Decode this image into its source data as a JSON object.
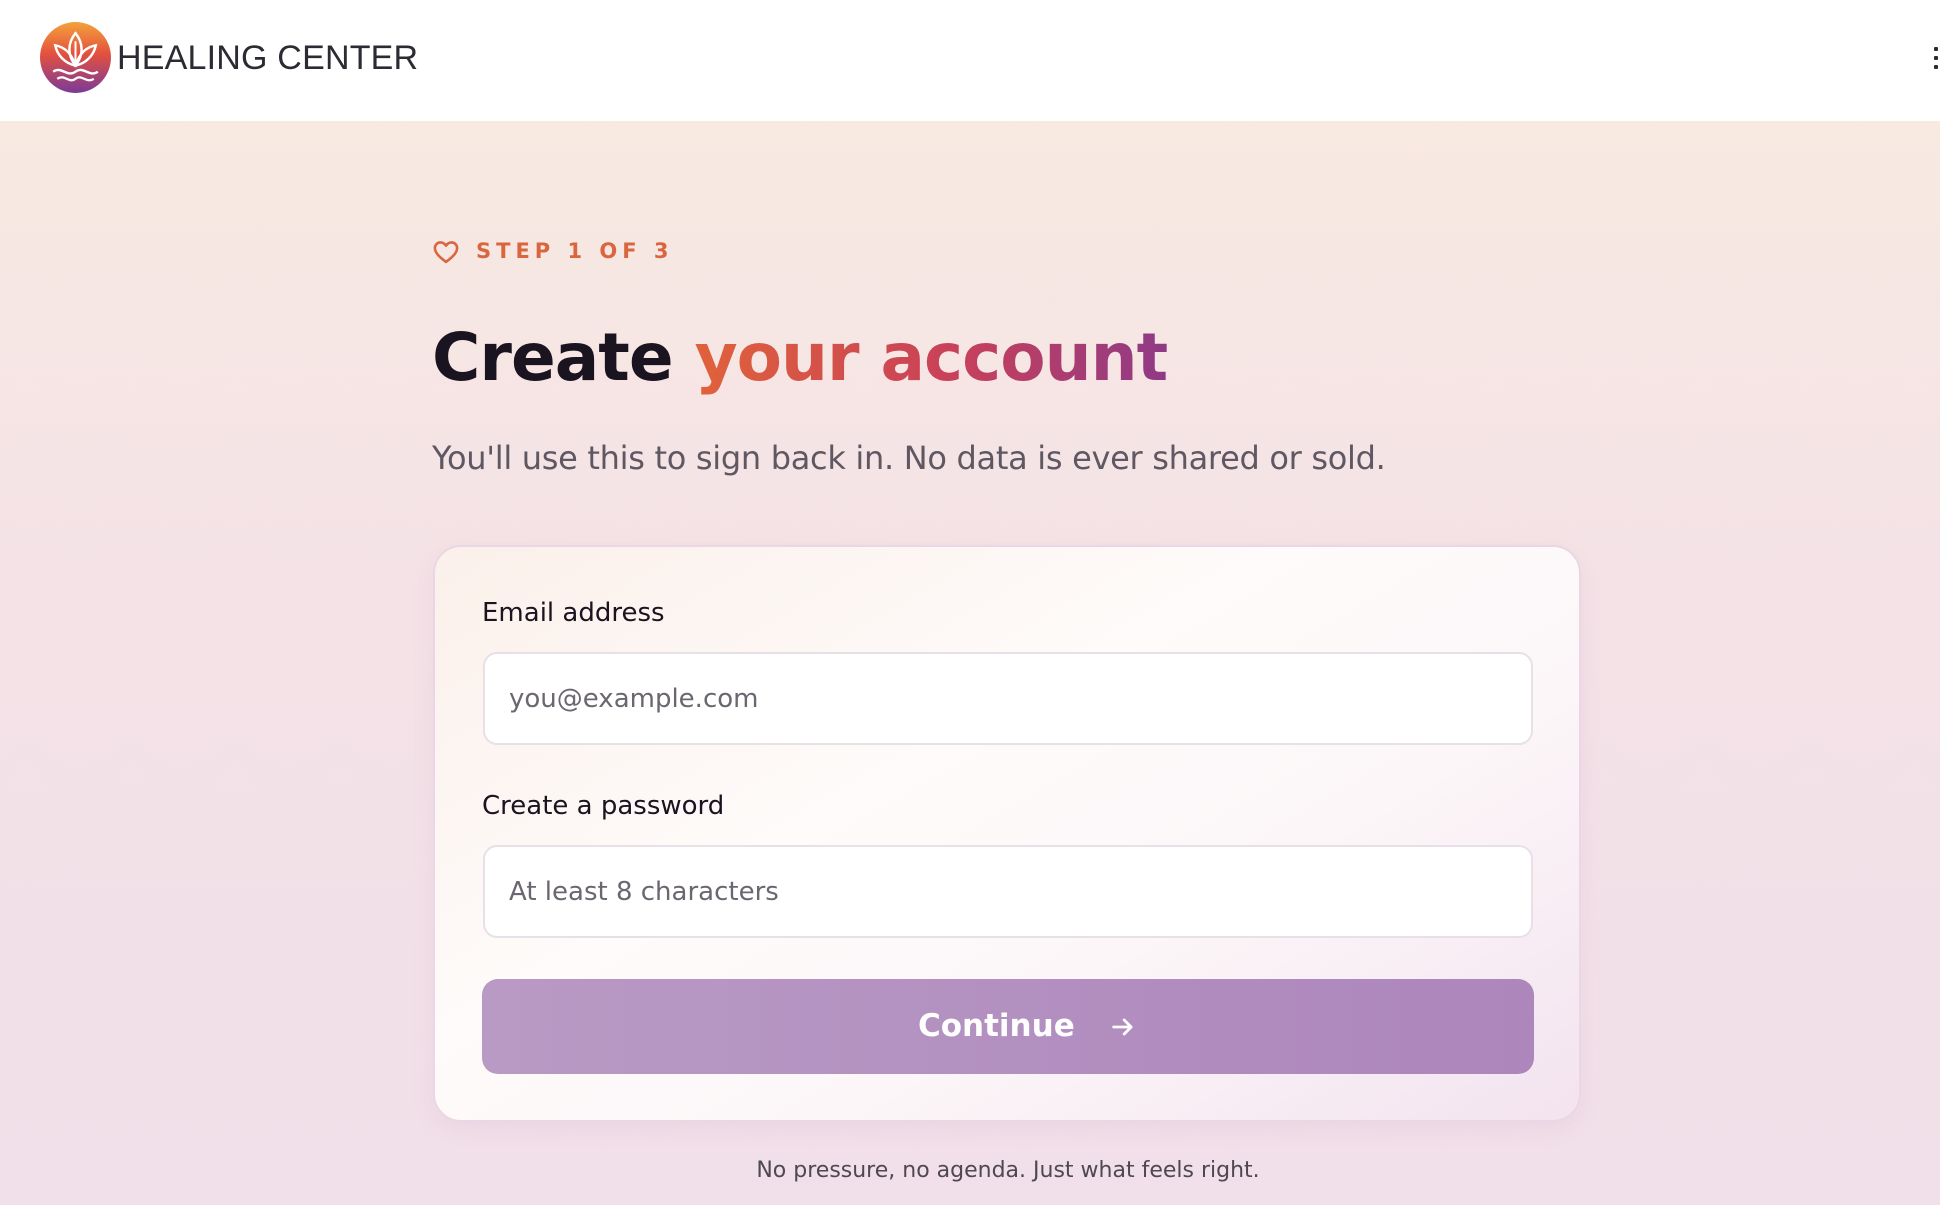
{
  "header": {
    "brand": "HEALING CENTER",
    "logo_icon": "lotus-logo-icon",
    "menu_icon": "kebab-menu-icon"
  },
  "step": {
    "icon": "heart-icon",
    "label": "STEP 1 OF 3"
  },
  "headline": {
    "plain": "Create",
    "highlight": "your account"
  },
  "subtitle": "You'll use this to sign back in. No data is ever shared or sold.",
  "form": {
    "email": {
      "label": "Email address",
      "value": "",
      "placeholder": "you@example.com"
    },
    "password": {
      "label": "Create a password",
      "value": "",
      "placeholder": "At least 8 characters"
    },
    "continue_label": "Continue",
    "continue_icon": "arrow-right-icon"
  },
  "footnote": "No pressure, no agenda. Just what feels right.",
  "colors": {
    "accent_orange": "#d9663e",
    "accent_magenta": "#c8405a",
    "accent_purple": "#8f3a86",
    "button": "#b394c2",
    "text_dark": "#1a1320"
  }
}
